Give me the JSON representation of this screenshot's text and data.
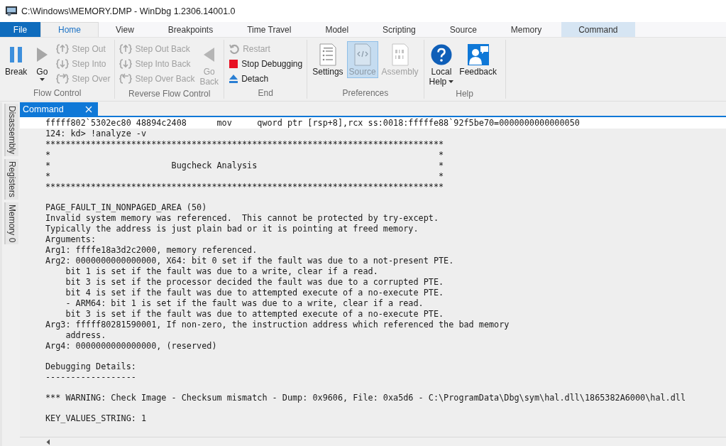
{
  "window": {
    "title": "C:\\Windows\\MEMORY.DMP - WinDbg 1.2306.14001.0"
  },
  "ribbon_tabs": [
    {
      "label": "File",
      "kind": "file",
      "selected": false
    },
    {
      "label": "Home",
      "kind": "normal",
      "selected": true
    },
    {
      "label": "View",
      "kind": "normal",
      "selected": false
    },
    {
      "label": "Breakpoints",
      "kind": "normal",
      "selected": false
    },
    {
      "label": "Time Travel",
      "kind": "normal",
      "selected": false
    },
    {
      "label": "Model",
      "kind": "normal",
      "selected": false
    },
    {
      "label": "Scripting",
      "kind": "normal",
      "selected": false
    },
    {
      "label": "Source",
      "kind": "normal",
      "selected": false
    },
    {
      "label": "Memory",
      "kind": "normal",
      "selected": false
    },
    {
      "label": "Command",
      "kind": "contextual",
      "selected": false
    }
  ],
  "ribbon_groups": [
    {
      "label": "Flow Control",
      "items": [
        {
          "label": "Break",
          "kind": "large",
          "disabled": false,
          "dropdown": false
        },
        {
          "label": "Go",
          "kind": "large",
          "disabled": false,
          "dropdown": true
        },
        {
          "label": "Step Out",
          "kind": "small",
          "disabled": true
        },
        {
          "label": "Step Into",
          "kind": "small",
          "disabled": true
        },
        {
          "label": "Step Over",
          "kind": "small",
          "disabled": true
        }
      ]
    },
    {
      "label": "Reverse Flow Control",
      "items": [
        {
          "label": "Step Out Back",
          "kind": "small",
          "disabled": true
        },
        {
          "label": "Step Into Back",
          "kind": "small",
          "disabled": true
        },
        {
          "label": "Step Over Back",
          "kind": "small",
          "disabled": true
        },
        {
          "label": "Go Back",
          "kind": "large",
          "disabled": true,
          "dropdown": false
        }
      ]
    },
    {
      "label": "End",
      "items": [
        {
          "label": "Restart",
          "kind": "small",
          "disabled": true
        },
        {
          "label": "Stop Debugging",
          "kind": "small",
          "disabled": false
        },
        {
          "label": "Detach",
          "kind": "small",
          "disabled": false
        }
      ]
    },
    {
      "label": "Preferences",
      "items": [
        {
          "label": "Settings",
          "kind": "large",
          "disabled": false,
          "dropdown": false,
          "selected": false
        },
        {
          "label": "Source",
          "kind": "large",
          "disabled": false,
          "dropdown": false,
          "selected": true
        },
        {
          "label": "Assembly",
          "kind": "large",
          "disabled": true,
          "dropdown": false,
          "selected": false
        }
      ]
    },
    {
      "label": "Help",
      "items": [
        {
          "label": "Local Help",
          "kind": "large",
          "disabled": false,
          "dropdown": true
        },
        {
          "label": "Feedback",
          "kind": "large",
          "disabled": false,
          "dropdown": false
        }
      ]
    }
  ],
  "side_tabs": [
    {
      "label": "Disassembly",
      "selected": false
    },
    {
      "label": "Registers",
      "selected": false
    },
    {
      "label": "Memory 0",
      "selected": false
    }
  ],
  "document_tab": {
    "label": "Command",
    "selected": true
  },
  "output": {
    "current_line": "fffff802`5302ec80 48894c2408      mov     qword ptr [rsp+8],rcx ss:0018:fffffe88`92f5be70=0000000000000050",
    "blocks": [
      [
        "124: kd> !analyze -v",
        "*******************************************************************************",
        [
          "*",
          "*"
        ],
        [
          "*",
          "Bugcheck Analysis",
          "*"
        ],
        [
          "*",
          "*"
        ],
        "*******************************************************************************"
      ],
      [
        "PAGE_FAULT_IN_NONPAGED_AREA (50)",
        "Invalid system memory was referenced.  This cannot be protected by try-except.",
        "Typically the address is just plain bad or it is pointing at freed memory.",
        "Arguments:",
        "Arg1: ffffe18a3d2c2000, memory referenced.",
        "Arg2: 0000000000000000, X64: bit 0 set if the fault was due to a not-present PTE.",
        "    bit 1 is set if the fault was due to a write, clear if a read.",
        "    bit 3 is set if the processor decided the fault was due to a corrupted PTE.",
        "    bit 4 is set if the fault was due to attempted execute of a no-execute PTE.",
        "    - ARM64: bit 1 is set if the fault was due to a write, clear if a read.",
        "    bit 3 is set if the fault was due to attempted execute of a no-execute PTE.",
        "Arg3: fffff80281590001, If non-zero, the instruction address which referenced the bad memory",
        "    address.",
        "Arg4: 0000000000000000, (reserved)"
      ],
      [
        "Debugging Details:",
        "------------------"
      ],
      [
        "*** WARNING: Check Image - Checksum mismatch - Dump: 0x9606, File: 0xa5d6 - C:\\ProgramData\\Dbg\\sym\\hal.dll\\1865382A6000\\hal.dll"
      ],
      [
        "KEY_VALUES_STRING: 1"
      ]
    ]
  }
}
